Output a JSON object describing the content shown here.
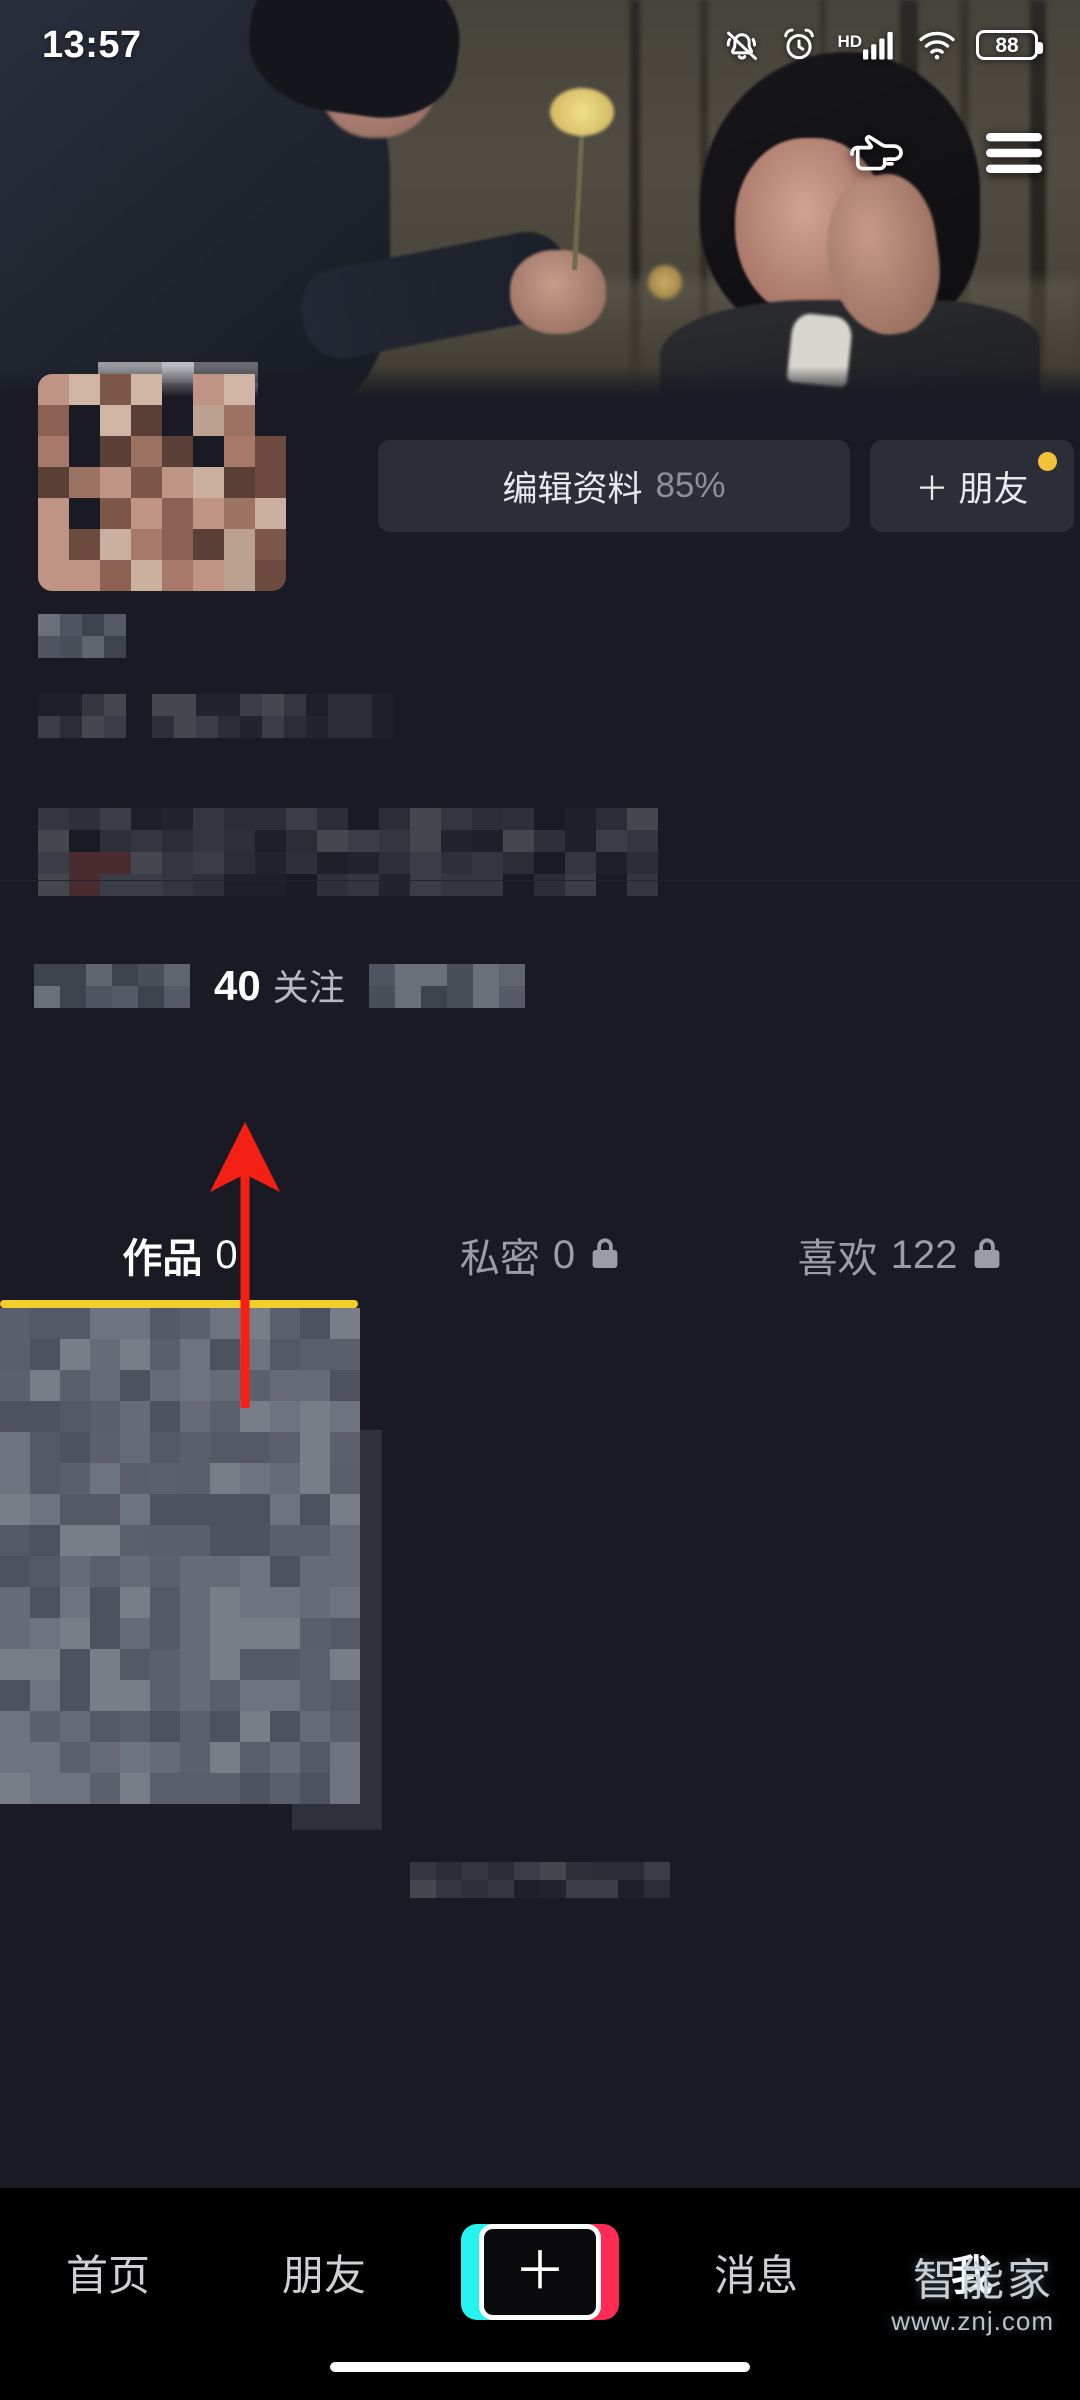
{
  "status_bar": {
    "time": "13:57",
    "battery_level": "88",
    "icons": [
      "bell-muted-icon",
      "alarm-clock-icon",
      "hd-icon",
      "signal-bars-icon",
      "wifi-icon",
      "battery-icon"
    ],
    "network_label": "HD"
  },
  "header": {
    "icons": [
      "pointing-hand-icon",
      "hamburger-menu-icon"
    ]
  },
  "cover": {
    "description": "park scene with man offering yellow flower to woman"
  },
  "profile": {
    "avatar_censored": true,
    "name_censored": true,
    "id_censored": true,
    "bio_censored": true,
    "edit_button": {
      "label": "编辑资料",
      "percent": "85%"
    },
    "friend_button": {
      "plus": "＋",
      "label": "朋友",
      "has_badge": true,
      "badge_color": "#F3C13A"
    }
  },
  "stats": {
    "following_count": "40",
    "following_label": "关注",
    "left_censored": true,
    "right_censored": true
  },
  "tabs": [
    {
      "label": "作品",
      "count": "0",
      "locked": false,
      "active": true
    },
    {
      "label": "私密",
      "count": "0",
      "locked": true,
      "active": false
    },
    {
      "label": "喜欢",
      "count": "122",
      "locked": true,
      "active": false
    }
  ],
  "tab_indicator_color": "#F2D02B",
  "content": {
    "thumbnail_censored": true,
    "caption_censored": true
  },
  "annotation": {
    "type": "red-arrow-up",
    "color": "#F32013"
  },
  "bottom_nav": [
    {
      "label": "首页",
      "type": "text",
      "active": false
    },
    {
      "label": "朋友",
      "type": "text",
      "active": false
    },
    {
      "label": "＋",
      "type": "create",
      "active": false
    },
    {
      "label": "消息",
      "type": "text",
      "active": false
    },
    {
      "label": "我",
      "type": "text",
      "active": true
    }
  ],
  "watermark": {
    "brand": "智能家",
    "url": "www.znj.com"
  },
  "colors": {
    "background": "#191A23",
    "nav_background": "#000000",
    "button": "#2b2d38",
    "accent_yellow": "#F2D02B",
    "accent_cyan": "#25F4EE",
    "accent_pink": "#FE2C55"
  }
}
